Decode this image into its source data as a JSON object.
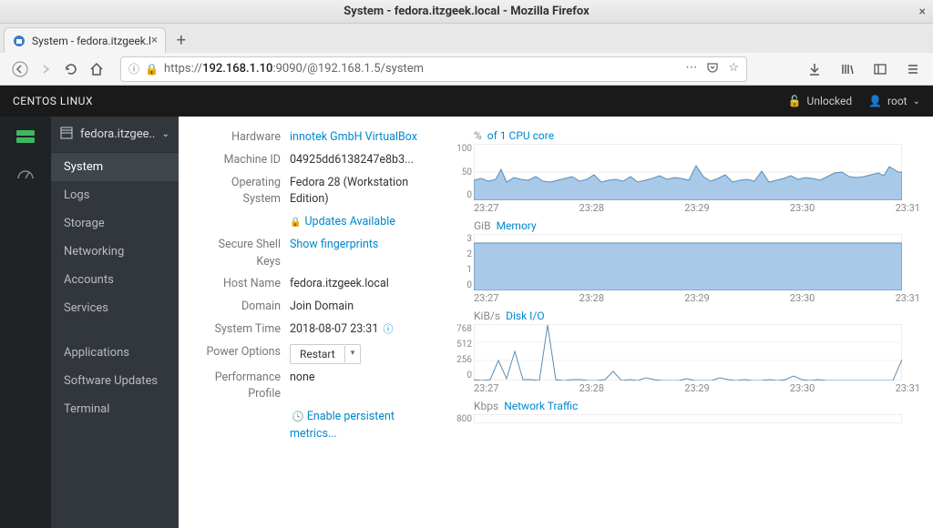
{
  "window": {
    "title": "System - fedora.itzgeek.local - Mozilla Firefox"
  },
  "tab": {
    "label": "System - fedora.itzgeek.l"
  },
  "url": {
    "prefix": "https://",
    "host": "192.168.1.10",
    "rest": ":9090/@192.168.1.5/system"
  },
  "header": {
    "brand": "CENTOS LINUX",
    "unlocked": "Unlocked",
    "user": "root"
  },
  "host": {
    "name": "fedora.itzgee..."
  },
  "nav": {
    "system": "System",
    "logs": "Logs",
    "storage": "Storage",
    "networking": "Networking",
    "accounts": "Accounts",
    "services": "Services",
    "applications": "Applications",
    "updates": "Software Updates",
    "terminal": "Terminal"
  },
  "info": {
    "hardware_label": "Hardware",
    "hardware_value": "innotek GmbH VirtualBox",
    "machineid_label": "Machine ID",
    "machineid_value": "04925dd6138247e8b3...",
    "os_label": "Operating System",
    "os_value": "Fedora 28 (Workstation Edition)",
    "updates_link": "Updates Available",
    "ssh_label": "Secure Shell Keys",
    "ssh_value": "Show fingerprints",
    "hostname_label": "Host Name",
    "hostname_value": "fedora.itzgeek.local",
    "domain_label": "Domain",
    "domain_value": "Join Domain",
    "time_label": "System Time",
    "time_value": "2018-08-07 23:31",
    "power_label": "Power Options",
    "power_btn": "Restart",
    "perf_label": "Performance Profile",
    "perf_value": "none",
    "metrics_link": "Enable persistent metrics..."
  },
  "charts": {
    "cpu": {
      "unit": "%",
      "title": "of 1 CPU core",
      "yticks": [
        "100",
        "50",
        "0"
      ],
      "xticks": [
        "23:27",
        "23:28",
        "23:29",
        "23:30",
        "23:31"
      ]
    },
    "mem": {
      "unit": "GiB",
      "title": "Memory",
      "yticks": [
        "3",
        "2",
        "1",
        "0"
      ],
      "xticks": [
        "23:27",
        "23:28",
        "23:29",
        "23:30",
        "23:31"
      ]
    },
    "disk": {
      "unit": "KiB/s",
      "title": "Disk I/O",
      "yticks": [
        "768",
        "512",
        "256",
        "0"
      ],
      "xticks": [
        "23:27",
        "23:28",
        "23:29",
        "23:30",
        "23:31"
      ]
    },
    "net": {
      "unit": "Kbps",
      "title": "Network Traffic",
      "yticks": [
        "800"
      ]
    }
  },
  "chart_data": [
    {
      "type": "area",
      "title": "% of 1 CPU core",
      "ylim": [
        0,
        100
      ],
      "x_range": [
        "23:27",
        "23:32"
      ],
      "values": [
        35,
        38,
        34,
        36,
        55,
        33,
        40,
        37,
        36,
        42,
        35,
        34,
        36,
        38,
        41,
        35,
        37,
        45,
        34,
        36,
        37,
        35,
        42,
        34,
        36,
        38,
        43,
        37,
        40,
        38,
        36,
        62,
        42,
        35,
        38,
        45,
        34,
        36,
        37,
        35,
        52,
        34,
        36,
        38,
        43,
        37,
        40,
        38,
        36,
        42,
        48,
        50,
        42,
        40,
        42,
        45,
        48,
        44,
        60,
        50
      ]
    },
    {
      "type": "area",
      "title": "Memory (GiB)",
      "ylim": [
        0,
        3.5
      ],
      "x_range": [
        "23:27",
        "23:32"
      ],
      "values": [
        2.9,
        2.9,
        2.9,
        2.9,
        2.9,
        2.9,
        2.9,
        2.9,
        2.9,
        2.9,
        2.9,
        2.9,
        2.9,
        2.9,
        2.9,
        2.9,
        2.9,
        2.9,
        2.9,
        2.9
      ]
    },
    {
      "type": "line",
      "title": "Disk I/O (KiB/s)",
      "ylim": [
        0,
        800
      ],
      "x_range": [
        "23:27",
        "23:32"
      ],
      "values": [
        10,
        0,
        5,
        280,
        20,
        410,
        10,
        5,
        0,
        790,
        10,
        0,
        5,
        10,
        0,
        0,
        5,
        120,
        0,
        10,
        0,
        30,
        5,
        0,
        0,
        0,
        25,
        0,
        0,
        0,
        40,
        10,
        0,
        5,
        0,
        0,
        5,
        0,
        10,
        60,
        5,
        0,
        10,
        0,
        0,
        0,
        0,
        0,
        0,
        0,
        290
      ]
    },
    {
      "type": "line",
      "title": "Network Traffic (Kbps)",
      "ylim": [
        0,
        800
      ],
      "x_range": [
        "23:27",
        "23:32"
      ],
      "values": []
    }
  ]
}
